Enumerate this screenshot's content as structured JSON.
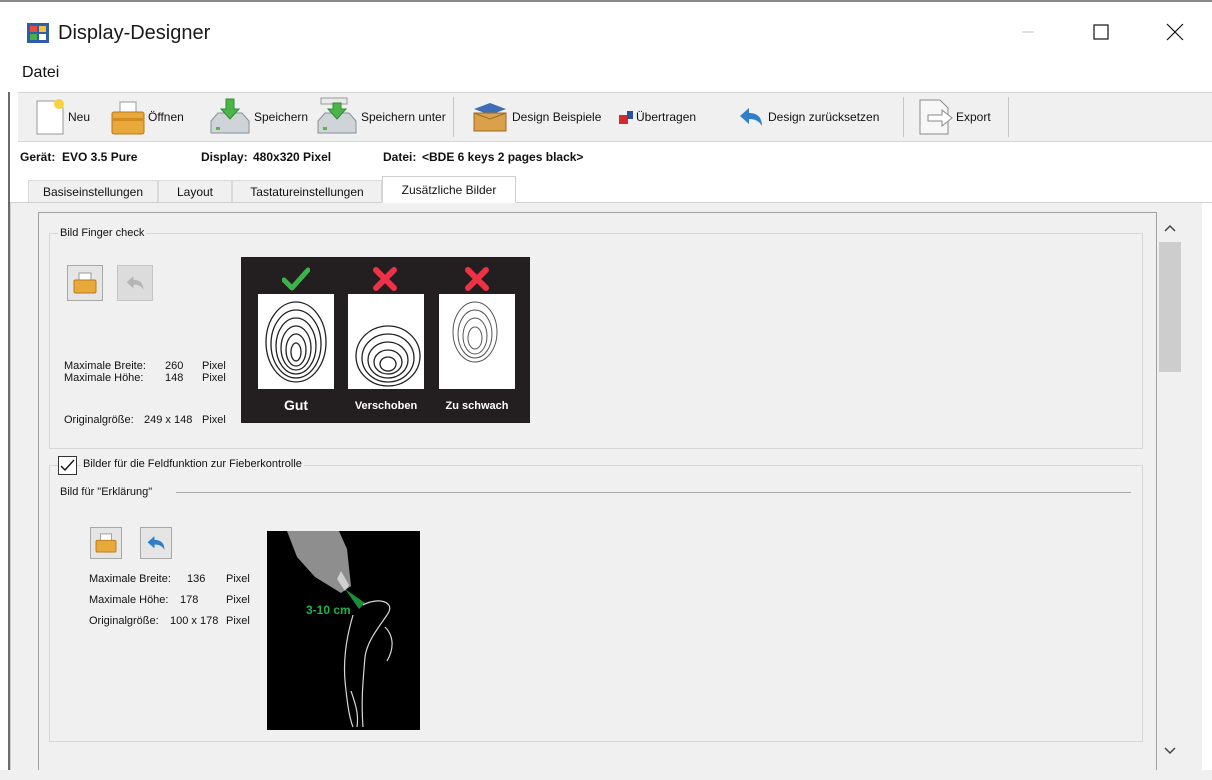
{
  "window": {
    "title": "Display-Designer",
    "controls": {
      "minimize": "minimize-icon",
      "maximize": "maximize-icon",
      "close": "close-icon"
    }
  },
  "menu": {
    "file": "Datei"
  },
  "toolbar": {
    "new_label": "Neu",
    "open_label": "Öffnen",
    "save_label": "Speichern",
    "save_as_label": "Speichern unter",
    "examples_label": "Design Beispiele",
    "transfer_label": "Übertragen",
    "reset_label": "Design zurücksetzen",
    "export_label": "Export"
  },
  "info": {
    "device_label": "Gerät:",
    "device_value": "EVO 3.5 Pure",
    "display_label": "Display:",
    "display_value": "480x320 Pixel",
    "file_label": "Datei:",
    "file_value": "<BDE 6 keys 2 pages black>"
  },
  "tabs": [
    {
      "label": "Basiseinstellungen",
      "active": false
    },
    {
      "label": "Layout",
      "active": false
    },
    {
      "label": "Tastatureinstellungen",
      "active": false
    },
    {
      "label": "Zusätzliche Bilder",
      "active": true
    }
  ],
  "finger_group": {
    "title": "Bild Finger check",
    "max_width_label": "Maximale Breite:",
    "max_width_value": "260",
    "max_height_label": "Maximale Höhe:",
    "max_height_value": "148",
    "unit": "Pixel",
    "original_label": "Originalgröße:",
    "original_value": "249 x 148",
    "captions": [
      "Gut",
      "Verschoben",
      "Zu schwach"
    ]
  },
  "fever_group": {
    "checkbox_label": "Bilder für die Feldfunktion zur Fieberkontrolle",
    "checked": true,
    "sub_title": "Bild für \"Erklärung\"",
    "max_width_label": "Maximale Breite:",
    "max_width_value": "136",
    "max_height_label": "Maximale Höhe:",
    "max_height_value": "178",
    "unit": "Pixel",
    "original_label": "Originalgröße:",
    "original_value": "100 x 178",
    "image_text": "3-10 cm"
  },
  "colors": {
    "check_green": "#3bb54a",
    "cross_red": "#ee3147",
    "fever_text_green": "#1db34a",
    "chrome_bg": "#f0f0f0"
  }
}
